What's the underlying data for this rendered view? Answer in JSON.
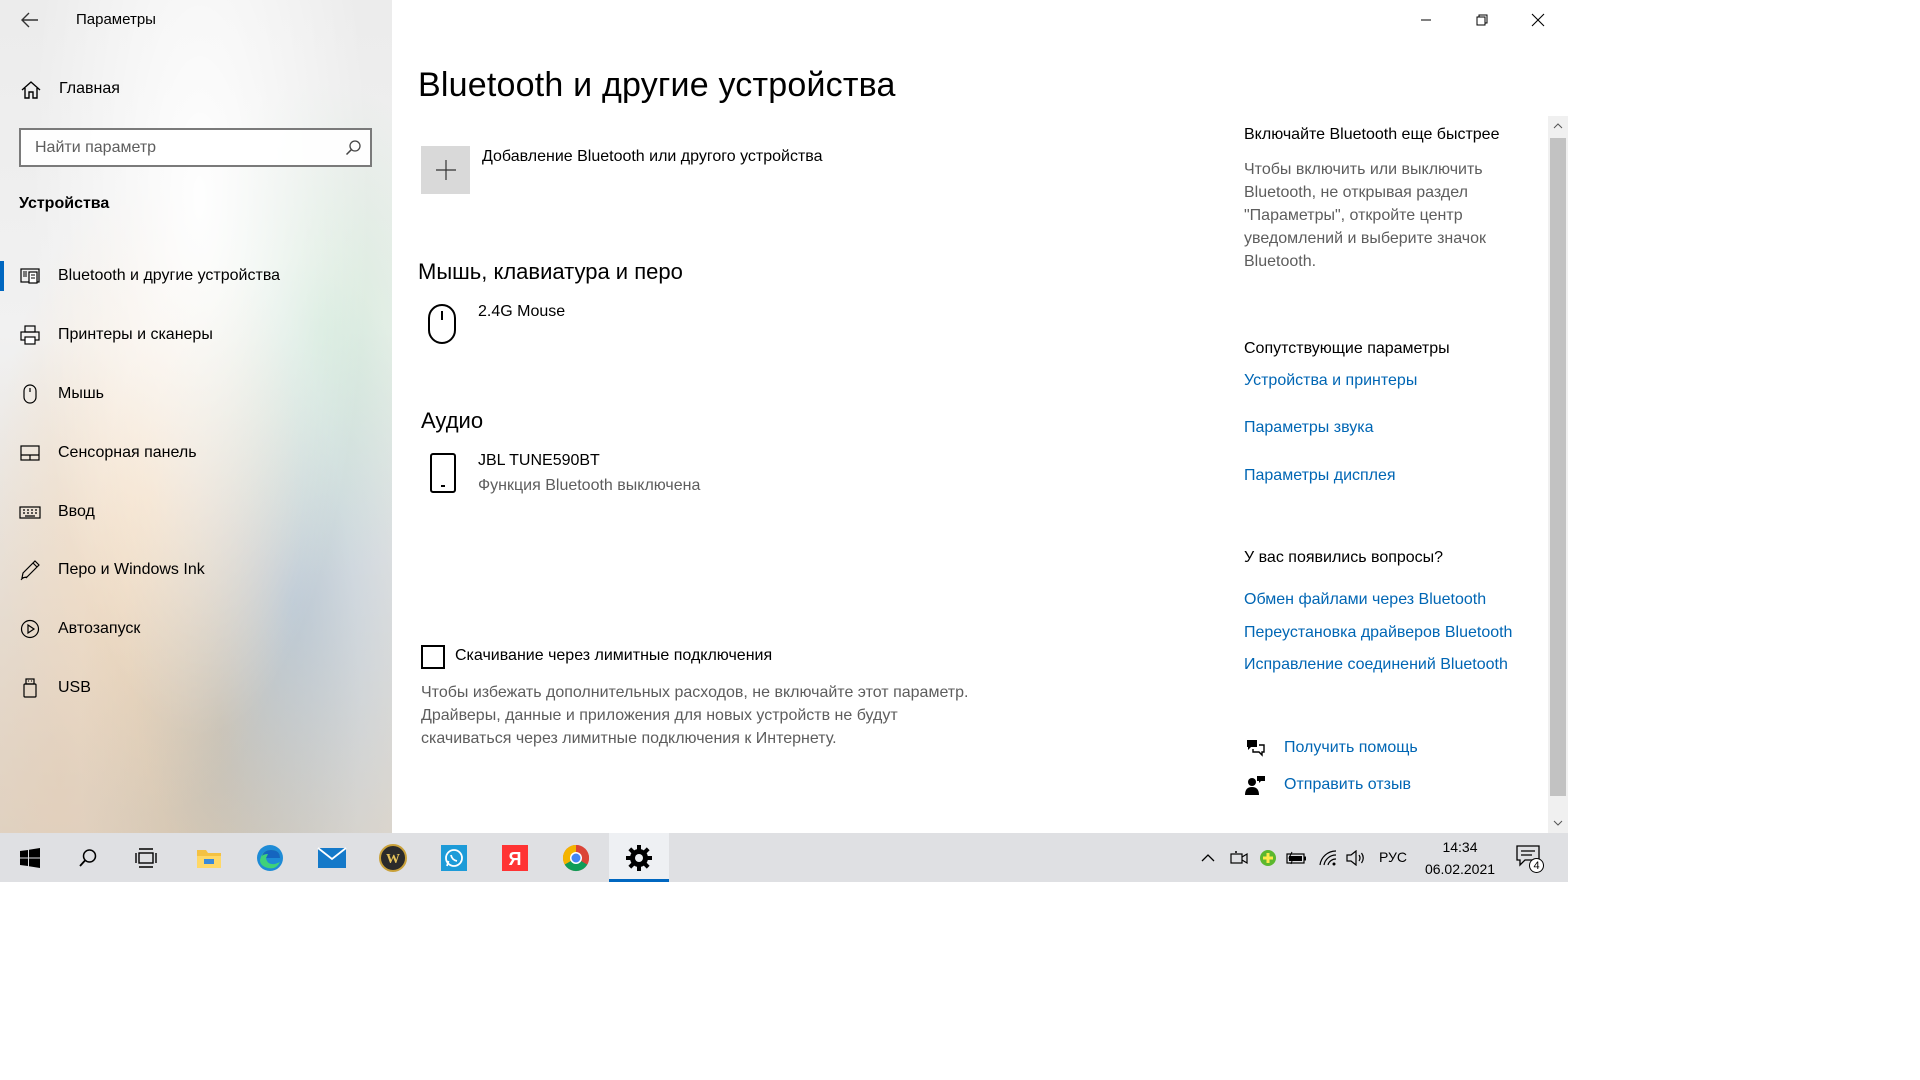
{
  "window": {
    "app_title": "Параметры",
    "controls": [
      "minimize",
      "restore",
      "close"
    ]
  },
  "sidebar": {
    "home_label": "Главная",
    "search_placeholder": "Найти параметр",
    "section_title": "Устройства",
    "items": [
      {
        "label": "Bluetooth и другие устройства",
        "icon": "bluetooth-devices-icon",
        "active": true
      },
      {
        "label": "Принтеры и сканеры",
        "icon": "printer-icon",
        "active": false
      },
      {
        "label": "Мышь",
        "icon": "mouse-icon",
        "active": false
      },
      {
        "label": "Сенсорная панель",
        "icon": "touchpad-icon",
        "active": false
      },
      {
        "label": "Ввод",
        "icon": "keyboard-icon",
        "active": false
      },
      {
        "label": "Перо и Windows Ink",
        "icon": "pen-icon",
        "active": false
      },
      {
        "label": "Автозапуск",
        "icon": "autoplay-icon",
        "active": false
      },
      {
        "label": "USB",
        "icon": "usb-icon",
        "active": false
      }
    ]
  },
  "main": {
    "title": "Bluetooth и другие устройства",
    "add_device_label": "Добавление Bluetooth или другого устройства",
    "groups": {
      "mouse_keyboard_pen": {
        "heading": "Мышь, клавиатура и перо",
        "devices": [
          {
            "name": "2.4G Mouse",
            "icon": "mouse-icon"
          }
        ]
      },
      "audio": {
        "heading": "Аудио",
        "devices": [
          {
            "name": "JBL TUNE590BT",
            "status": "Функция Bluetooth выключена",
            "icon": "phone-icon"
          }
        ]
      }
    },
    "metered": {
      "label": "Скачивание через лимитные подключения",
      "checked": false,
      "description": "Чтобы избежать дополнительных расходов, не включайте этот параметр. Драйверы, данные и приложения для новых устройств не будут скачиваться через лимитные подключения к Интернету."
    }
  },
  "right": {
    "tip_title": "Включайте Bluetooth еще быстрее",
    "tip_text": "Чтобы включить или выключить Bluetooth, не открывая раздел \"Параметры\", откройте центр уведомлений и выберите значок Bluetooth.",
    "related_title": "Сопутствующие параметры",
    "related_links": [
      "Устройства и принтеры",
      "Параметры звука",
      "Параметры дисплея"
    ],
    "questions_title": "У вас появились вопросы?",
    "question_links": [
      "Обмен файлами через Bluetooth",
      "Переустановка драйверов Bluetooth",
      "Исправление соединений Bluetooth"
    ],
    "get_help": "Получить помощь",
    "feedback": "Отправить отзыв"
  },
  "taskbar": {
    "apps": [
      "start-icon",
      "search-icon",
      "task-view-icon",
      "file-explorer-icon",
      "edge-icon",
      "mail-icon",
      "wow-icon",
      "whatsapp-icon",
      "yandex-icon",
      "chrome-icon",
      "settings-icon"
    ],
    "active_app": "settings-icon",
    "language": "РУС",
    "time": "14:34",
    "date": "06.02.2021",
    "notifications": "4",
    "colors": {
      "accent": "#0067c0",
      "link": "#0066b4",
      "taskbar_bg": "#dfe0e3"
    }
  }
}
